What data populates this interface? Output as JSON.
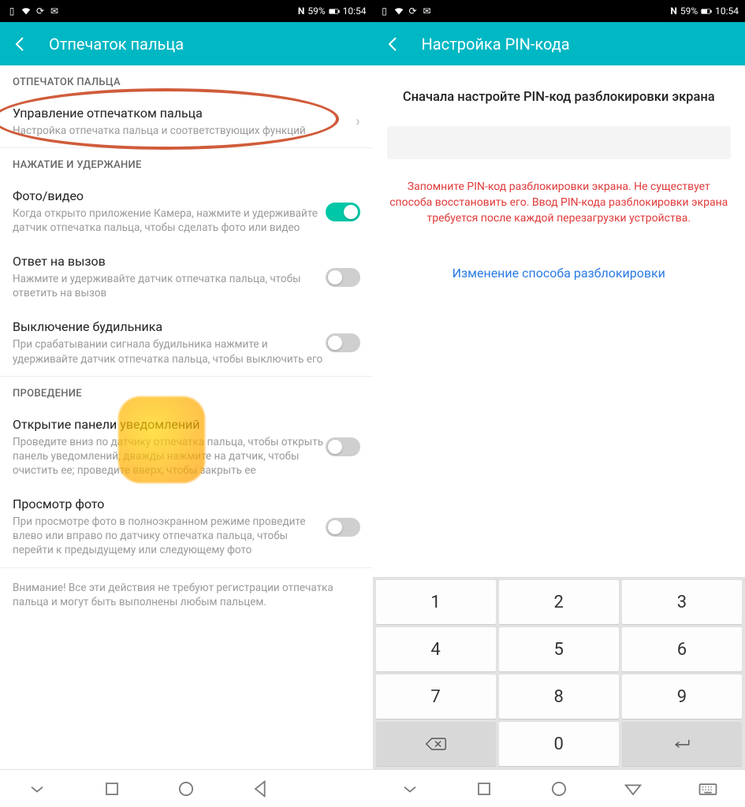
{
  "statusbar": {
    "nfc": "N",
    "battery": "59%",
    "time": "10:54"
  },
  "left": {
    "appbar_title": "Отпечаток пальца",
    "sections": {
      "fingerprint_header": "ОТПЕЧАТОК ПАЛЬЦА",
      "fingerprint_mgmt_title": "Управление отпечатком пальца",
      "fingerprint_mgmt_desc": "Настройка отпечатка пальца и соответствующих функций",
      "press_hold_header": "НАЖАТИЕ И УДЕРЖАНИЕ",
      "photo_title": "Фото/видео",
      "photo_desc": "Когда открыто приложение Камера, нажмите и удерживайте датчик отпечатка пальца, чтобы сделать фото или видео",
      "answer_title": "Ответ на вызов",
      "answer_desc": "Нажмите и удерживайте датчик отпечатка пальца, чтобы ответить на вызов",
      "alarm_title": "Выключение будильника",
      "alarm_desc": "При срабатывании сигнала будильника нажмите и удерживайте датчик отпечатка пальца, чтобы выключить его",
      "swipe_header": "ПРОВЕДЕНИЕ",
      "notif_title": "Открытие панели уведомлений",
      "notif_desc": "Проведите вниз по датчику отпечатка пальца, чтобы открыть панель уведомлений; дважды нажмите на датчик, чтобы очистить ее; проведите вверх, чтобы закрыть ее",
      "photos_title": "Просмотр фото",
      "photos_desc": "При просмотре фото в полноэкранном режиме проведите влево или вправо по датчику отпечатка пальца, чтобы перейти к предыдущему или следующему фото",
      "footer": "Внимание! Все эти действия не требуют регистрации отпечатка пальца и могут быть выполнены любым пальцем."
    }
  },
  "right": {
    "appbar_title": "Настройка PIN-кода",
    "heading": "Сначала настройте PIN-код разблокировки экрана",
    "warning": "Запомните PIN-код разблокировки экрана. Не существует способа восстановить его. Ввод PIN-кода разблокировки экрана требуется после каждой перезагрузки устройства.",
    "link": "Изменение способа разблокировки",
    "keys": {
      "k1": "1",
      "k2": "2",
      "k3": "3",
      "k4": "4",
      "k5": "5",
      "k6": "6",
      "k7": "7",
      "k8": "8",
      "k9": "9",
      "k0": "0"
    }
  }
}
